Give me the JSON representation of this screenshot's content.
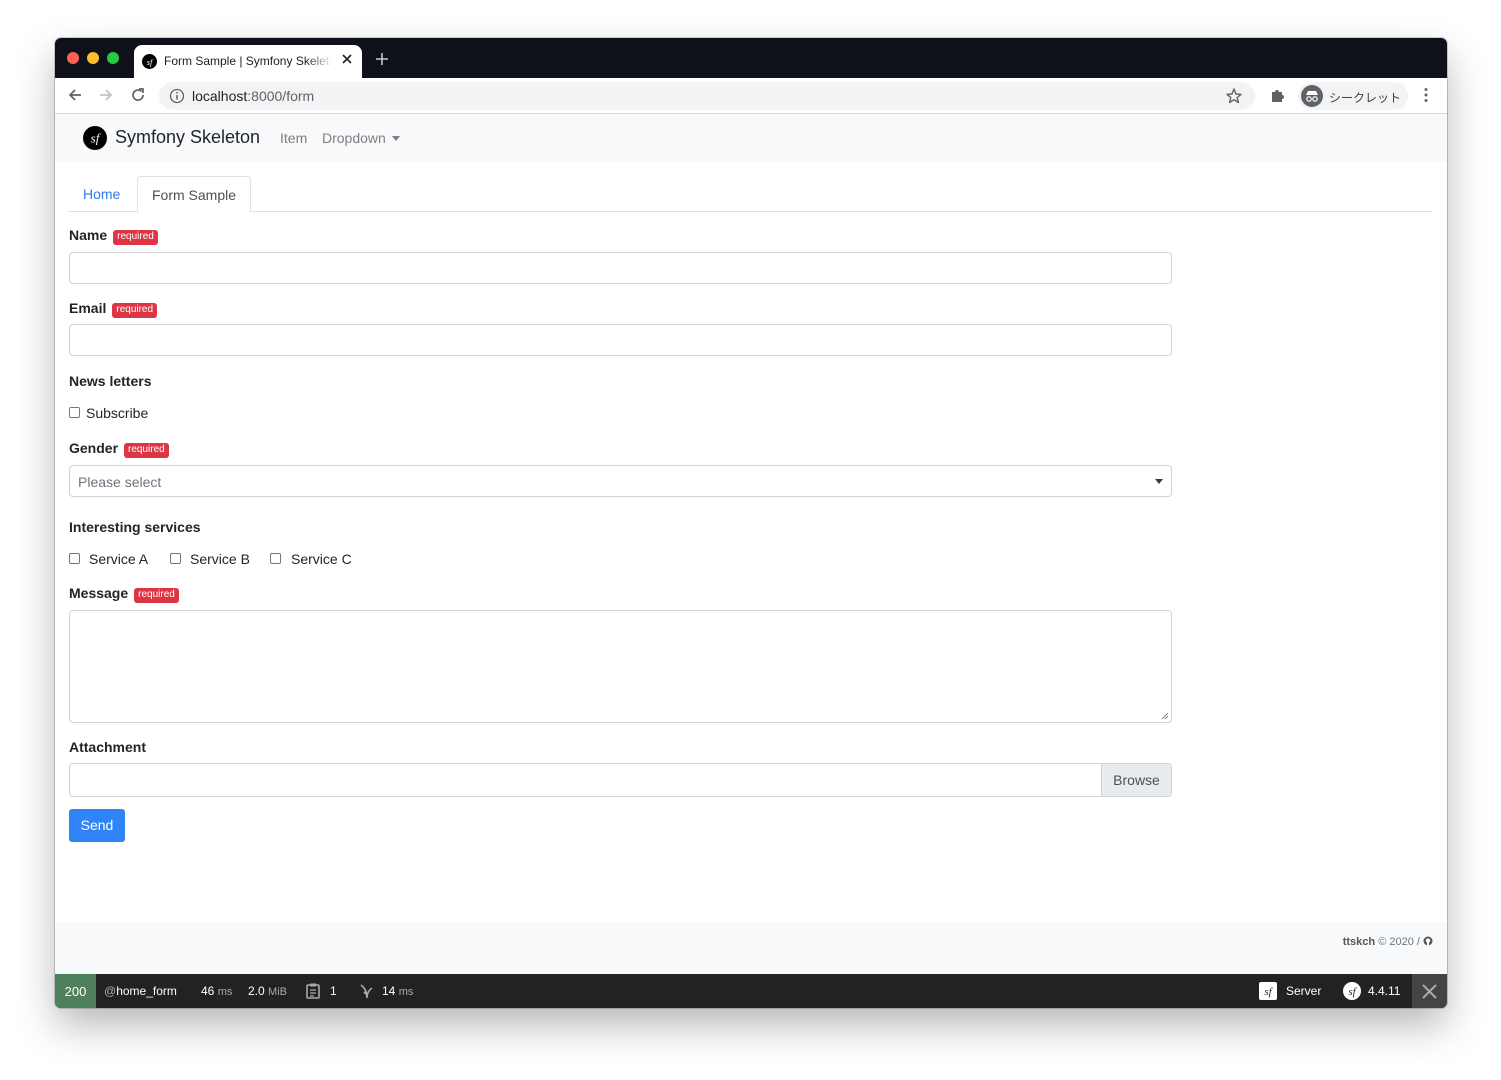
{
  "browser": {
    "tab_title": "Form Sample | Symfony Skeleton",
    "url_host": "localhost",
    "url_path": ":8000/form",
    "profile_label": "シークレット"
  },
  "navbar": {
    "brand": "Symfony Skeleton",
    "items": [
      {
        "label": "Item"
      },
      {
        "label": "Dropdown"
      }
    ]
  },
  "tabs": [
    {
      "label": "Home",
      "active": false
    },
    {
      "label": "Form Sample",
      "active": true
    }
  ],
  "form": {
    "required_badge": "required",
    "name": {
      "label": "Name",
      "value": ""
    },
    "email": {
      "label": "Email",
      "value": ""
    },
    "newsletters": {
      "label": "News letters",
      "option": "Subscribe",
      "checked": false
    },
    "gender": {
      "label": "Gender",
      "selected": "Please select"
    },
    "services": {
      "label": "Interesting services",
      "options": [
        "Service A",
        "Service B",
        "Service C"
      ]
    },
    "message": {
      "label": "Message",
      "value": ""
    },
    "attachment": {
      "label": "Attachment",
      "browse": "Browse"
    },
    "submit": "Send"
  },
  "footer": {
    "author": "ttskch",
    "year": "© 2020 /"
  },
  "debug_toolbar": {
    "status": "200",
    "route": "home_form",
    "time_value": "46",
    "time_unit": "ms",
    "memory_value": "2.0",
    "memory_unit": "MiB",
    "forms_count": "1",
    "twig_time": "14",
    "twig_unit": "ms",
    "server_label": "Server",
    "symfony_version": "4.4.11"
  },
  "colors": {
    "primary": "#2f84f6",
    "danger": "#dc3545",
    "status_ok": "#4f805d"
  }
}
